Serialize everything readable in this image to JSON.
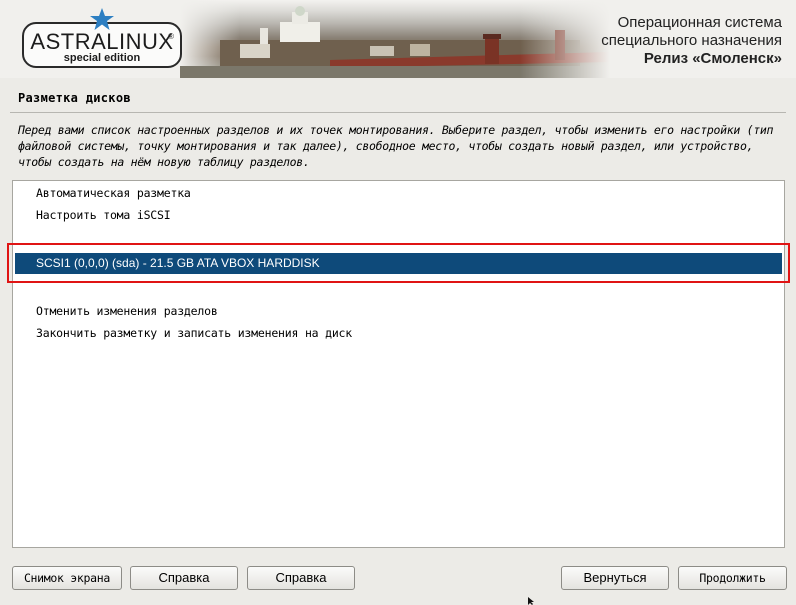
{
  "header": {
    "logo_main": "ASTRALINUX",
    "logo_registered": "®",
    "logo_sub": "special edition",
    "os_line1": "Операционная система",
    "os_line2": "специального назначения",
    "os_release": "Релиз «Смоленск»",
    "star_color": "#2d7fc2"
  },
  "page": {
    "title": "Разметка дисков",
    "description": "Перед вами список настроенных разделов и их точек монтирования. Выберите раздел, чтобы изменить его настройки (тип файловой системы, точку монтирования и так далее), свободное место, чтобы создать новый раздел, или устройство, чтобы создать на нём новую таблицу разделов."
  },
  "list": {
    "items": [
      {
        "label": "Автоматическая разметка"
      },
      {
        "label": "Настроить тома iSCSI"
      },
      {
        "label": "SCSI1 (0,0,0) (sda) - 21.5 GB ATA VBOX HARDDISK",
        "selected": true
      },
      {
        "label": "Отменить изменения разделов"
      },
      {
        "label": "Закончить разметку и записать изменения на диск"
      }
    ],
    "selection_color": "#0e4a7a",
    "highlight_color": "#e01414"
  },
  "buttons": {
    "screenshot": "Снимок экрана",
    "help1": "Справка",
    "help2": "Справка",
    "back": "Вернуться",
    "continue": "Продолжить"
  }
}
